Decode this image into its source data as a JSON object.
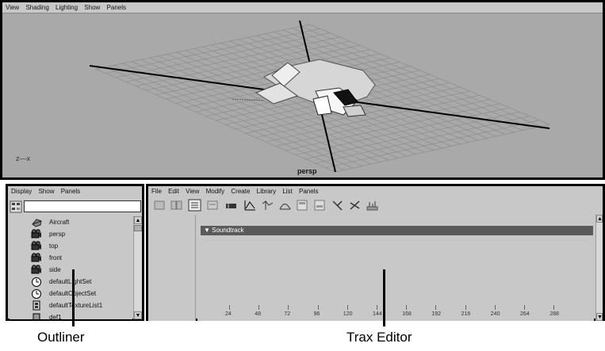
{
  "viewport": {
    "menu": [
      "View",
      "Shading",
      "Lighting",
      "Show",
      "Panels"
    ],
    "camera_label": "persp",
    "axis_label": "z—x"
  },
  "outliner": {
    "menu": [
      "Display",
      "Show",
      "Panels"
    ],
    "filter_value": "",
    "items": [
      {
        "label": "Aircraft",
        "icon": "transform-icon"
      },
      {
        "label": "persp",
        "icon": "camera-icon"
      },
      {
        "label": "top",
        "icon": "camera-icon"
      },
      {
        "label": "front",
        "icon": "camera-icon"
      },
      {
        "label": "side",
        "icon": "camera-icon"
      },
      {
        "label": "defaultLightSet",
        "icon": "set-icon"
      },
      {
        "label": "defaultObjectSet",
        "icon": "set-icon"
      },
      {
        "label": "defaultTextureList1",
        "icon": "texture-list-icon"
      },
      {
        "label": "def1",
        "icon": "node-icon"
      }
    ]
  },
  "trax": {
    "menu": [
      "File",
      "Edit",
      "View",
      "Modify",
      "Create",
      "Library",
      "List",
      "Panels"
    ],
    "toolbar_icons": [
      "load-character-icon",
      "group-icon",
      "list-icon",
      "frame-icon",
      "clip-icon",
      "graph-icon",
      "keys-icon",
      "curve-icon",
      "outliner-icon",
      "outliner2-icon",
      "pin-icon",
      "scissors-icon",
      "timeline-icon"
    ],
    "soundtrack_label": "Soundtrack",
    "ruler_ticks": [
      "24",
      "48",
      "72",
      "96",
      "120",
      "144",
      "168",
      "192",
      "216",
      "240",
      "264",
      "288"
    ]
  },
  "callouts": {
    "outliner": "Outliner",
    "trax": "Trax Editor"
  },
  "colors": {
    "panel_bg": "#c8c8c8",
    "viewport_bg": "#a9a9a9",
    "soundtrack_bar": "#5a5a5a"
  }
}
